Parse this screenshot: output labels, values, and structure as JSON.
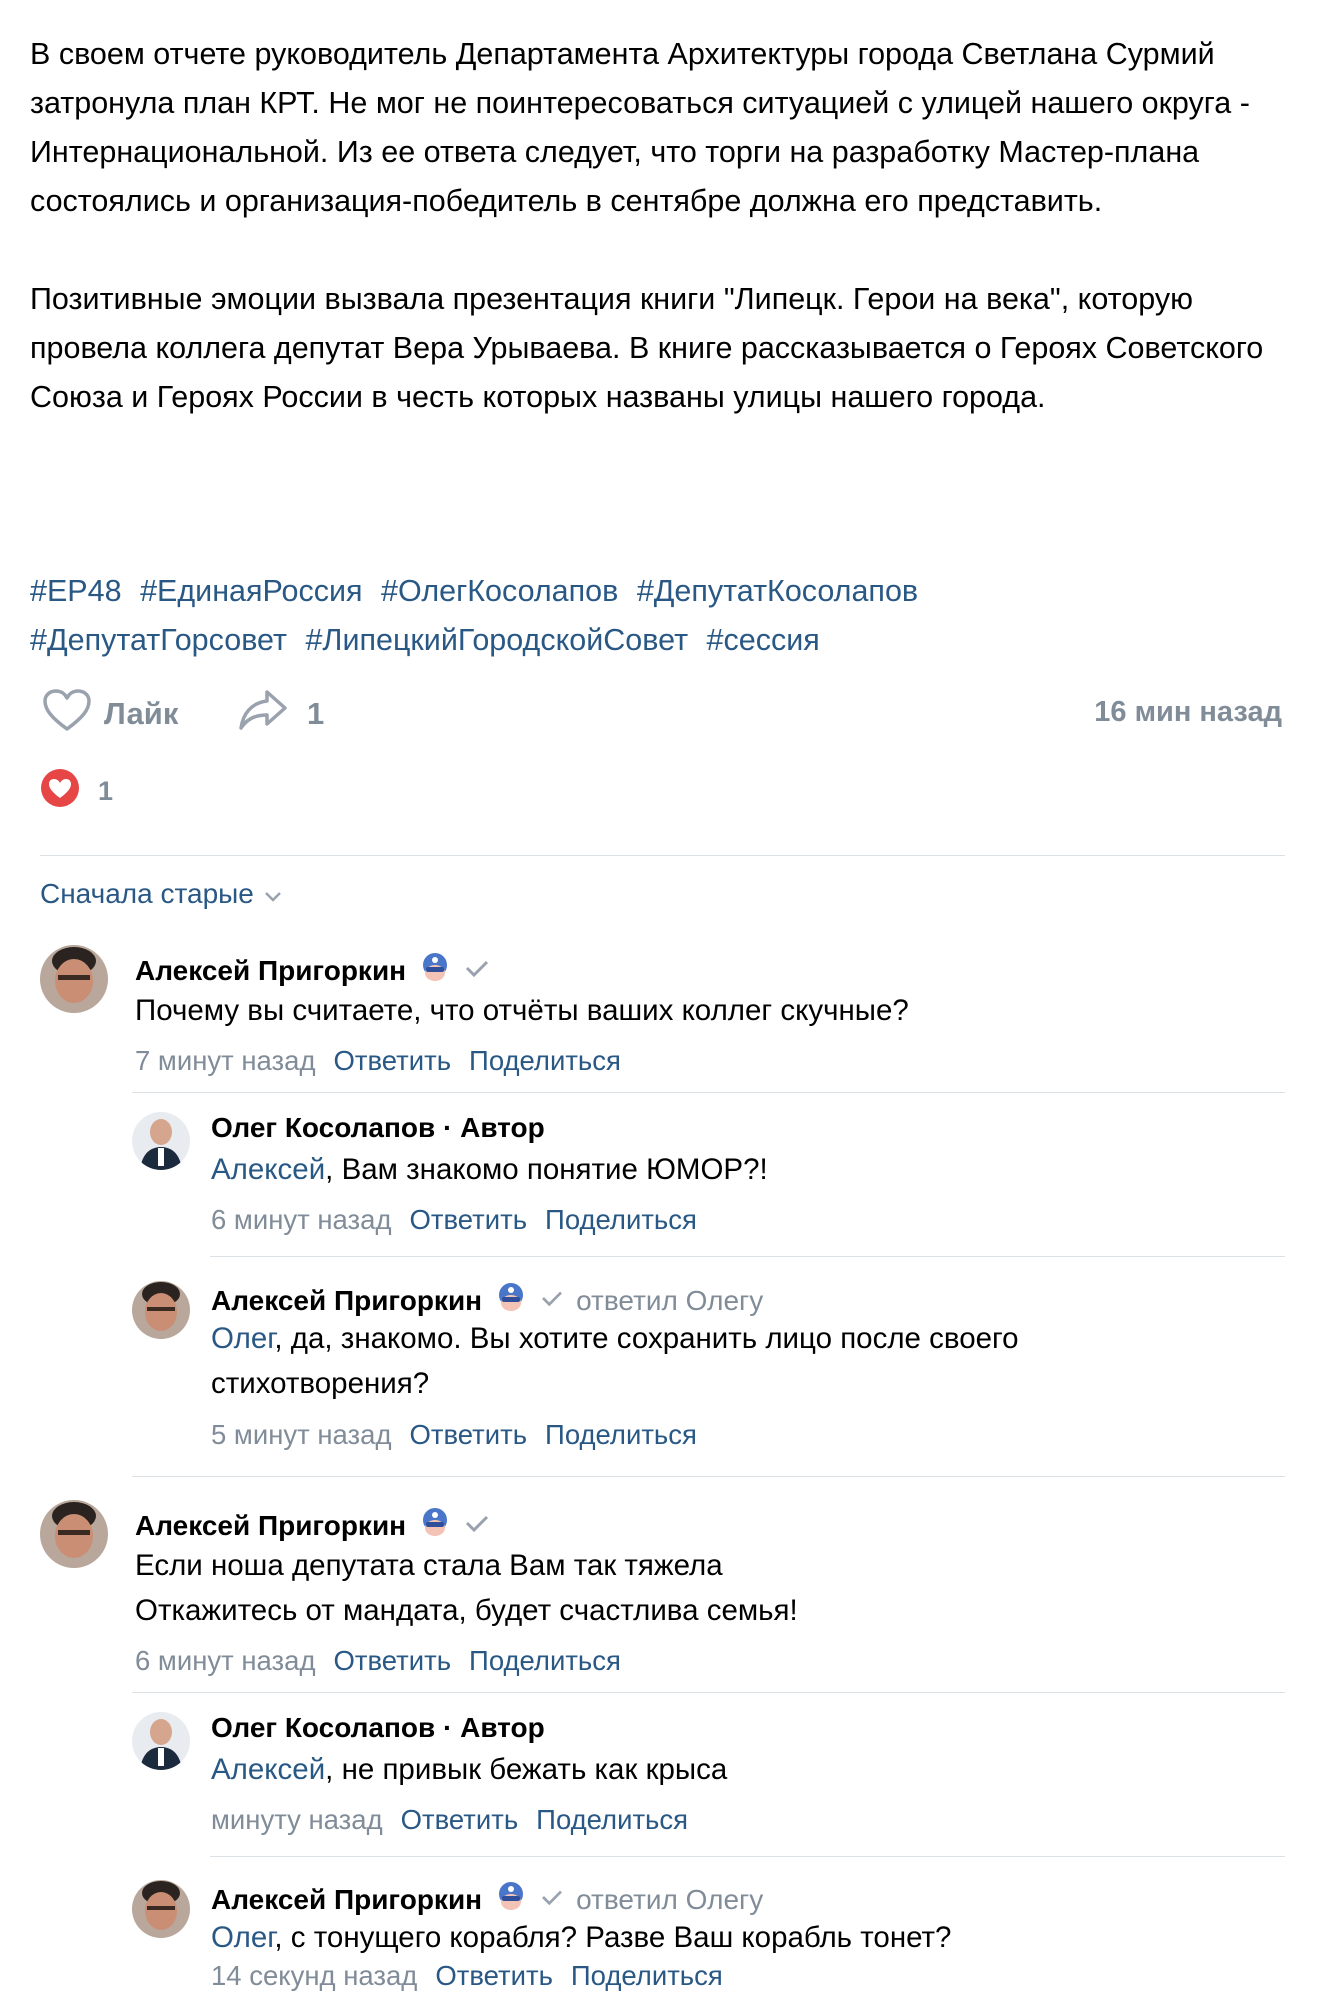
{
  "post": {
    "paragraphs": [
      "В своем отчете руководитель Департамента Архитектуры города Светлана Сурмий затронула план КРТ. Не мог не поинтересоваться ситуацией с улицей нашего округа - Интернациональной. Из ее ответа следует, что торги на разработку Мастер-плана состоялись и организация-победитель в сентябре должна его представить.",
      "Позитивные эмоции вызвала презентация книги \"Липецк. Герои на века\", которую провела коллега депутат Вера Урываева. В книге рассказывается о Героях Советского Союза и Героях России в честь которых названы улицы нашего города."
    ],
    "hashtags": [
      "#ЕР48",
      "#ЕдинаяРоссия",
      "#ОлегКосолапов",
      "#ДепутатКосолапов",
      "#ДепутатГорсовет",
      "#ЛипецкийГородскойСовет",
      "#сессия"
    ],
    "like_label": "Лайк",
    "share_count": "1",
    "time": "16 мин назад",
    "reaction_count": "1"
  },
  "sort_label": "Сначала старые",
  "actions": {
    "reply": "Ответить",
    "share": "Поделиться"
  },
  "comments": [
    {
      "author": "Алексей Пригоркин",
      "text": "Почему вы считаете, что отчёты ваших коллег скучные?",
      "time": "7 минут назад"
    },
    {
      "author": "Олег Косолапов · Автор",
      "mention": "Алексей",
      "text": ", Вам знакомо понятие ЮМОР?!",
      "time": "6 минут назад"
    },
    {
      "author": "Алексей Пригоркин",
      "reply_to": "ответил Олегу",
      "mention": "Олег",
      "text": ", да, знакомо. Вы хотите сохранить лицо после своего стихотворения?",
      "time": "5 минут назад"
    },
    {
      "author": "Алексей Пригоркин",
      "text": "Если ноша депутата стала Вам так тяжела\nОткажитесь от мандата, будет счастлива семья!",
      "time": "6 минут назад"
    },
    {
      "author": "Олег Косолапов · Автор",
      "mention": "Алексей",
      "text": ", не привык бежать как крыса",
      "time": "минуту назад"
    },
    {
      "author": "Алексей Пригоркин",
      "reply_to": "ответил Олегу",
      "mention": "Олег",
      "text": ", с тонущего корабля? Разве Ваш корабль тонет?",
      "time": "14 секунд назад"
    }
  ],
  "colors": {
    "link": "#2a5885",
    "muted": "#818c99",
    "divider": "#dce1e6",
    "heart": "#e64646"
  },
  "icons": {
    "like": "heart-outline-icon",
    "share": "share-arrow-icon",
    "reaction": "heart-reaction-icon",
    "sort": "chevron-down-icon",
    "verified": "checkmark-icon",
    "badge": "mask-badge-icon"
  }
}
